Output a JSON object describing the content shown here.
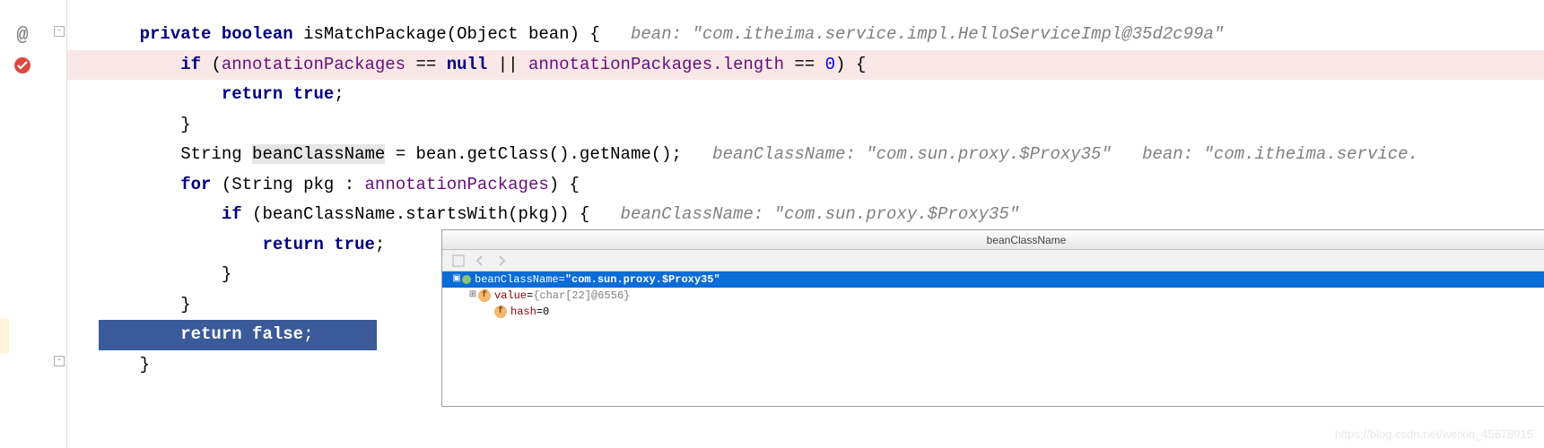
{
  "code": {
    "line1": {
      "kw_private": "private",
      "kw_boolean": "boolean",
      "method": "isMatchPackage",
      "param_type": "Object",
      "param_name": "bean",
      "brace": ") {",
      "hint_label": "bean:",
      "hint_value": "\"com.itheima.service.impl.HelloServiceImpl@35d2c99a\""
    },
    "line2": {
      "kw_if": "if",
      "open": "(",
      "field1": "annotationPackages",
      "op_eq": "==",
      "kw_null": "null",
      "op_or": "||",
      "field2": "annotationPackages",
      "dot_length": ".length",
      "op_eq2": "==",
      "num_zero": "0",
      "close": ") {"
    },
    "line3": {
      "kw_return": "return",
      "kw_true": "true",
      "semi": ";"
    },
    "line4": {
      "brace": "}"
    },
    "line5": {
      "type_string": "String",
      "var": "beanClassName",
      "eq": "=",
      "expr": "bean.getClass().getName();",
      "hint1_label": "beanClassName:",
      "hint1_value": "\"com.sun.proxy.$Proxy35\"",
      "hint2_label": "bean:",
      "hint2_value": "\"com.itheima.service."
    },
    "line6": {
      "kw_for": "for",
      "open": "(",
      "type_string": "String",
      "var_pkg": "pkg",
      "colon": ":",
      "field": "annotationPackages",
      "close": ") {"
    },
    "line7": {
      "kw_if": "if",
      "open": "(",
      "var": "beanClassName",
      "method": ".startsWith(pkg)) {",
      "hint_label": "beanClassName:",
      "hint_value": "\"com.sun.proxy.$Proxy35\""
    },
    "line8": {
      "kw_return": "return",
      "kw_true": "true",
      "semi": ";"
    },
    "line9": {
      "brace": "}"
    },
    "line10": {
      "brace": "}"
    },
    "line11": {
      "kw_return": "return",
      "kw_false": "false",
      "semi": ";"
    },
    "line12": {
      "brace": "}"
    }
  },
  "debug": {
    "header": "beanClassName",
    "root_var": "beanClassName",
    "root_eq": " = ",
    "root_val": "\"com.sun.proxy.$Proxy35\"",
    "child1_name": "value",
    "child1_eq": " = ",
    "child1_val": "{char[22]@6556}",
    "child2_name": "hash",
    "child2_eq": " = ",
    "child2_val": "0"
  },
  "watermark": "https://blog.csdn.net/weixin_45678915"
}
